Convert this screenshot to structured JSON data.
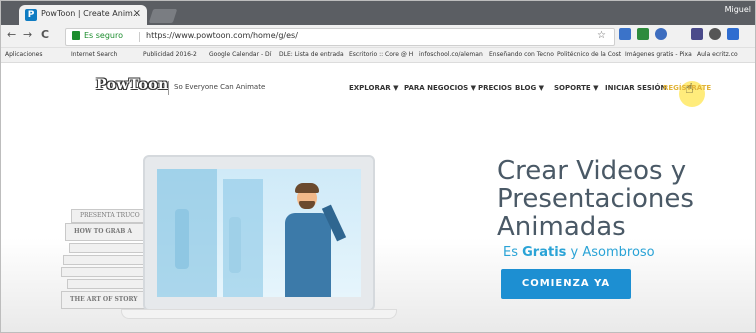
{
  "browser": {
    "tab_title": "PowToon | Create Anim...",
    "tab_close": "×",
    "user_label": "Miguel",
    "nav_back": "←",
    "nav_forward": "→",
    "nav_reload": "C",
    "secure_label": "Es seguro",
    "url": "https://www.powtoon.com/home/g/es/",
    "star": "☆"
  },
  "bookmarks": [
    "Aplicaciones",
    "Internet Search",
    "Publicidad 2016-2",
    "Google Calendar - Dí",
    "DLE: Lista de entrada",
    "Escritorio :: Core @ H",
    "infoschool.co/aleman",
    "Enseñando con Tecno",
    "Politécnico de la Cost",
    "Imágenes gratis - Pixa",
    "Aula ecritz.co"
  ],
  "site": {
    "logo": "PowToon",
    "tagline": "So Everyone Can Animate",
    "nav": {
      "explore": "EXPLORAR ▼",
      "business": "PARA NEGOCIOS ▼",
      "pricing": "PRECIOS",
      "blog": "BLOG ▼",
      "support": "SOPORTE ▼",
      "login": "INICIAR SESIÓN",
      "signup": "REGÍSTRATE"
    },
    "hero": {
      "line1": "Crear Videos y",
      "line2": "Presentaciones",
      "line3": "Animadas",
      "sub_bold": "Gratis",
      "sub_prefix": "Es ",
      "sub_suffix": " y Asombroso",
      "cta": "COMIENZA YA"
    },
    "books": [
      "PRESENTA TRUCO",
      "HOW TO GRAB A",
      "",
      "",
      "THE ART OF STORY"
    ]
  },
  "colors": {
    "cta_bg": "#1d8fd2",
    "hero_text": "#4a5966",
    "sub_text": "#2aa3d6"
  }
}
